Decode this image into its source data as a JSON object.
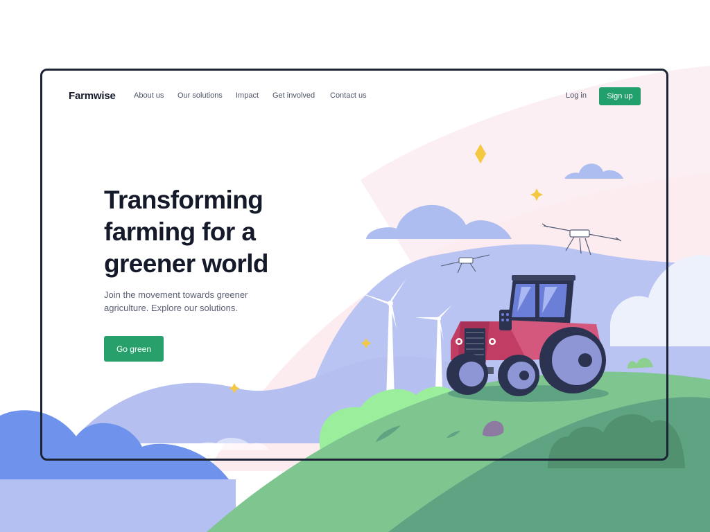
{
  "brand": {
    "name": "Farmwise"
  },
  "nav": {
    "links": [
      {
        "label": "About us"
      },
      {
        "label": "Our solutions"
      },
      {
        "label": "Impact"
      },
      {
        "label": "Get involved"
      },
      {
        "label": "Contact us"
      }
    ],
    "login_label": "Log in",
    "signup_label": "Sign up"
  },
  "hero": {
    "title": "Transforming farming for a greener world",
    "subtitle": "Join the movement towards greener agriculture. Explore our solutions.",
    "cta_label": "Go green"
  },
  "colors": {
    "accent": "#22a06b",
    "text_dark": "#141a29",
    "text_muted": "#5b6275",
    "tractor_body": "#c13d64"
  }
}
